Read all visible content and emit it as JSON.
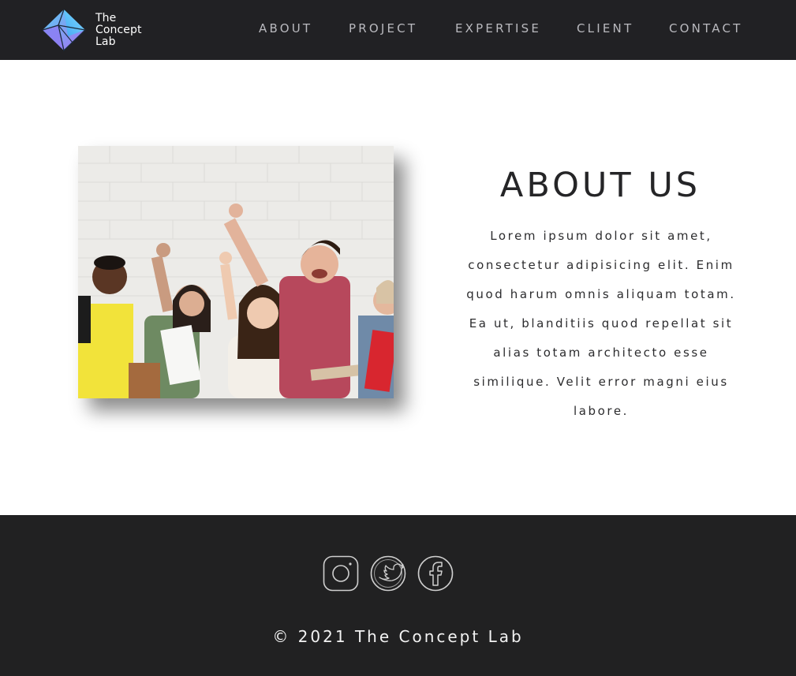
{
  "brand": {
    "name_line1": "The",
    "name_line2": "Concept",
    "name_line3": "Lab",
    "logo_icon": "diamond-logo-icon",
    "colors": {
      "logo_gradient_start": "#5ad0f5",
      "logo_gradient_end": "#a66cf0"
    }
  },
  "nav": {
    "items": [
      {
        "label": "ABOUT"
      },
      {
        "label": "PROJECT"
      },
      {
        "label": "EXPERTISE"
      },
      {
        "label": "CLIENT"
      },
      {
        "label": "CONTACT"
      }
    ]
  },
  "about": {
    "title": "ABOUT US",
    "body": "Lorem ipsum dolor sit amet, consectetur adipisicing elit. Enim quod harum omnis aliquam totam. Ea ut, blanditiis quod repellat sit alias totam architecto esse similique. Velit error magni eius labore.",
    "image_icon": "group-photo-image"
  },
  "footer": {
    "social": [
      {
        "icon": "instagram-icon"
      },
      {
        "icon": "twitter-icon"
      },
      {
        "icon": "facebook-icon"
      }
    ],
    "copyright": "© 2021 The Concept Lab"
  },
  "colors": {
    "header_bg": "#212124",
    "footer_bg": "#212122",
    "nav_text": "#b9b9be",
    "body_text": "#2c2c2e"
  }
}
